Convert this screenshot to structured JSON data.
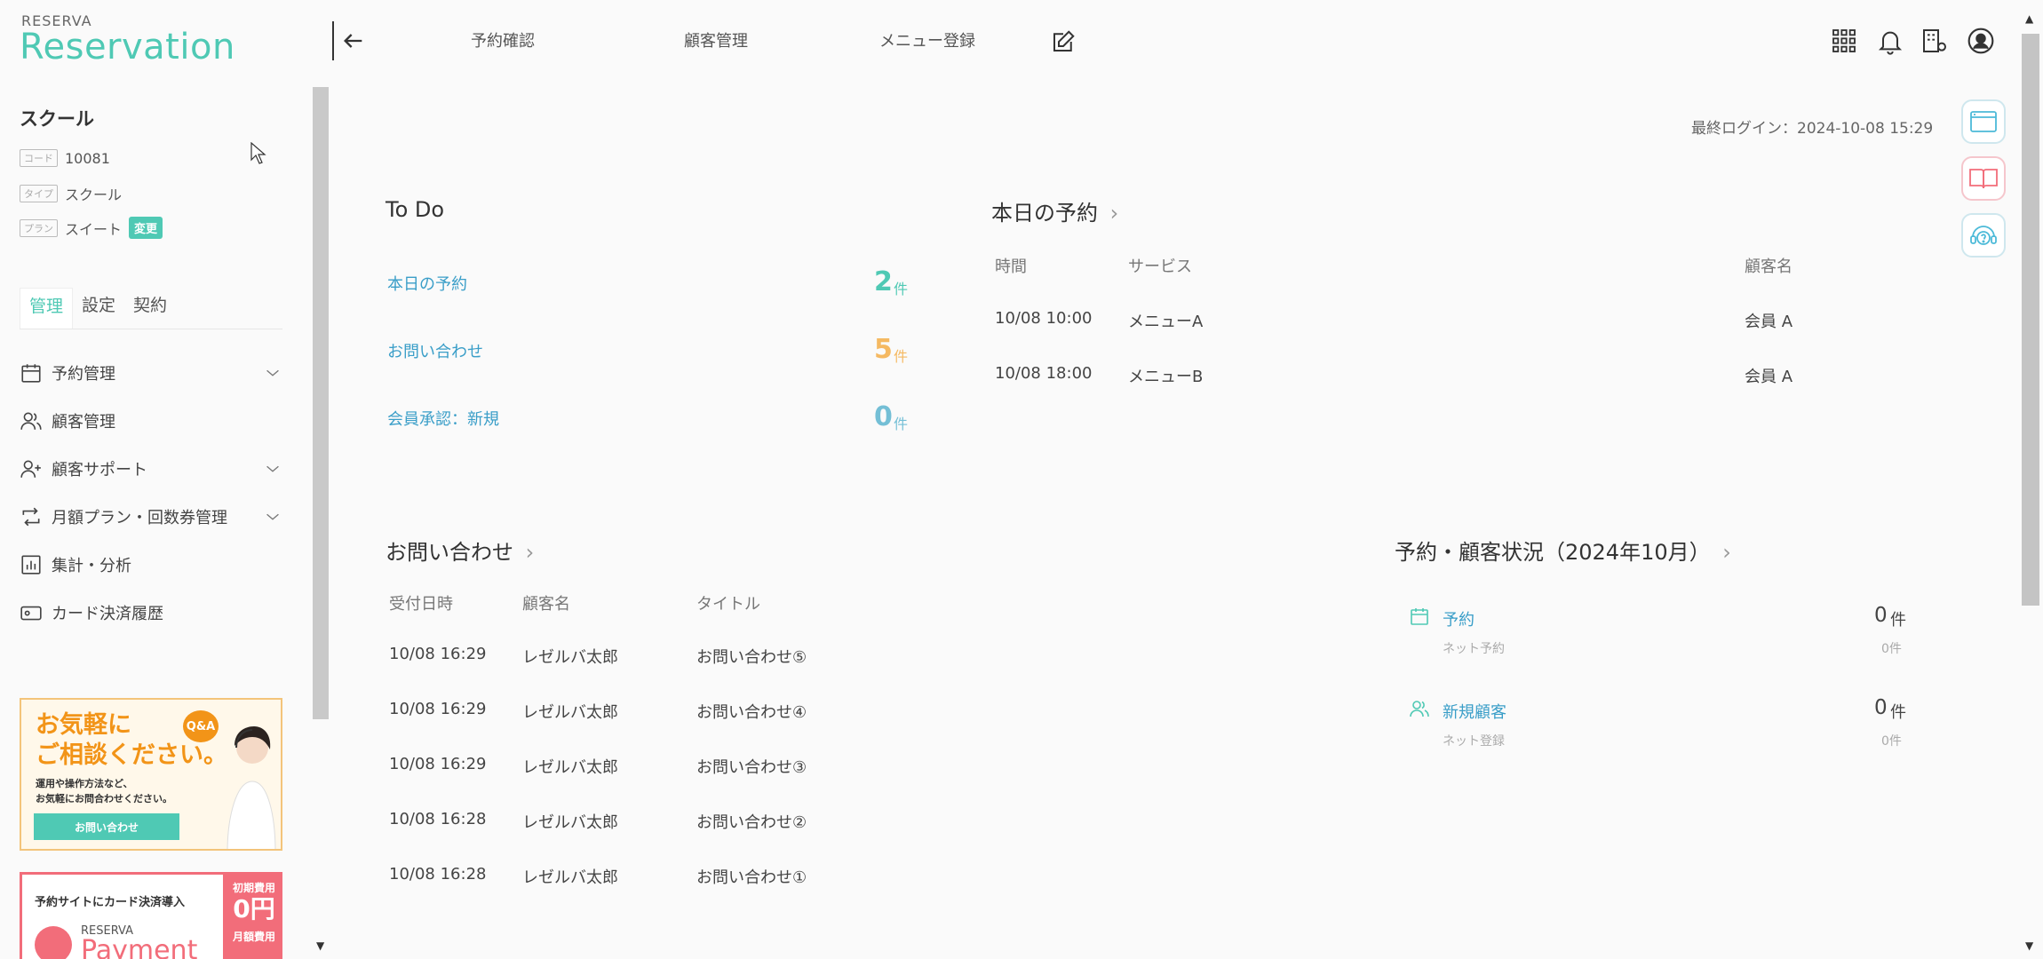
{
  "colors": {
    "accent": "#4fc9b4",
    "link": "#3a9ec8",
    "orange": "#f5b962",
    "blue": "#74bfd6",
    "pink": "#f26d7a"
  },
  "brand": {
    "small": "RESERVA",
    "main": "Reservation"
  },
  "header": {
    "nav": [
      "予約確認",
      "顧客管理",
      "メニュー登録"
    ],
    "icons": [
      "grid-icon",
      "bell-icon",
      "building-settings-icon",
      "user-circle-icon"
    ]
  },
  "shop": {
    "name": "スクール",
    "code_tag": "コード",
    "code": "10081",
    "type_tag": "タイプ",
    "type": "スクール",
    "plan_tag": "プラン",
    "plan": "スイート",
    "change": "変更"
  },
  "sidebar": {
    "tabs": [
      "管理",
      "設定",
      "契約"
    ],
    "items": [
      {
        "label": "予約管理",
        "icon": "calendar-icon",
        "expandable": true
      },
      {
        "label": "顧客管理",
        "icon": "users-icon",
        "expandable": false
      },
      {
        "label": "顧客サポート",
        "icon": "user-plus-icon",
        "expandable": true
      },
      {
        "label": "月額プラン・回数券管理",
        "icon": "repeat-icon",
        "expandable": true
      },
      {
        "label": "集計・分析",
        "icon": "chart-icon",
        "expandable": false
      },
      {
        "label": "カード決済履歴",
        "icon": "card-icon",
        "expandable": false
      }
    ]
  },
  "banners": {
    "help": {
      "line1": "お気軽に",
      "line2": "ご相談ください。",
      "qa": "Q&A",
      "desc1": "運用や操作方法など、",
      "desc2": "お気軽にお問合わせください。",
      "button": "お問い合わせ"
    },
    "payment": {
      "headline": "予約サイトにカード決済導入",
      "brand": "RESERVA",
      "name": "Payment",
      "fee1_label": "初期費用",
      "fee1": "0円",
      "fee2_label": "月額費用"
    }
  },
  "last_login": "最終ログイン：2024-10-08 15:29",
  "todo": {
    "title": "To Do",
    "unit": "件",
    "items": [
      {
        "label": "本日の予約",
        "count": "2",
        "color": "#4fc9b4"
      },
      {
        "label": "お問い合わせ",
        "count": "5",
        "color": "#f5b962"
      },
      {
        "label": "会員承認：新規",
        "count": "0",
        "color": "#74bfd6"
      }
    ]
  },
  "today": {
    "title": "本日の予約",
    "headers": [
      "時間",
      "サービス",
      "顧客名"
    ],
    "rows": [
      [
        "10/08 10:00",
        "メニューA",
        "会員 A"
      ],
      [
        "10/08 18:00",
        "メニューB",
        "会員 A"
      ]
    ]
  },
  "inquiries": {
    "title": "お問い合わせ",
    "headers": [
      "受付日時",
      "顧客名",
      "タイトル"
    ],
    "rows": [
      [
        "10/08 16:29",
        "レゼルバ太郎",
        "お問い合わせ⑤"
      ],
      [
        "10/08 16:29",
        "レゼルバ太郎",
        "お問い合わせ④"
      ],
      [
        "10/08 16:29",
        "レゼルバ太郎",
        "お問い合わせ③"
      ],
      [
        "10/08 16:28",
        "レゼルバ太郎",
        "お問い合わせ②"
      ],
      [
        "10/08 16:28",
        "レゼルバ太郎",
        "お問い合わせ①"
      ]
    ]
  },
  "status": {
    "title": "予約・顧客状況（2024年10月）",
    "unit": "件",
    "items": [
      {
        "label": "予約",
        "sub": "ネット予約",
        "value": "0",
        "subvalue": "0件",
        "icon": "calendar-icon"
      },
      {
        "label": "新規顧客",
        "sub": "ネット登録",
        "value": "0",
        "subvalue": "0件",
        "icon": "users-icon"
      }
    ]
  }
}
